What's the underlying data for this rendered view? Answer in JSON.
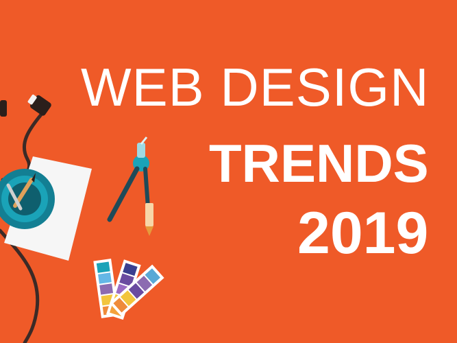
{
  "headline": {
    "line1": "WEB DESIGN",
    "line2": "TRENDS",
    "line3": "2019"
  },
  "colors": {
    "background": "#ef5a28",
    "text": "#ffffff",
    "cable": "#3b2a26",
    "accent_teal": "#1aa3b8"
  },
  "illustrations": [
    "earphones-icon",
    "paper-sheet",
    "pencil-cup-icon",
    "compass-icon",
    "color-swatch-icon"
  ]
}
